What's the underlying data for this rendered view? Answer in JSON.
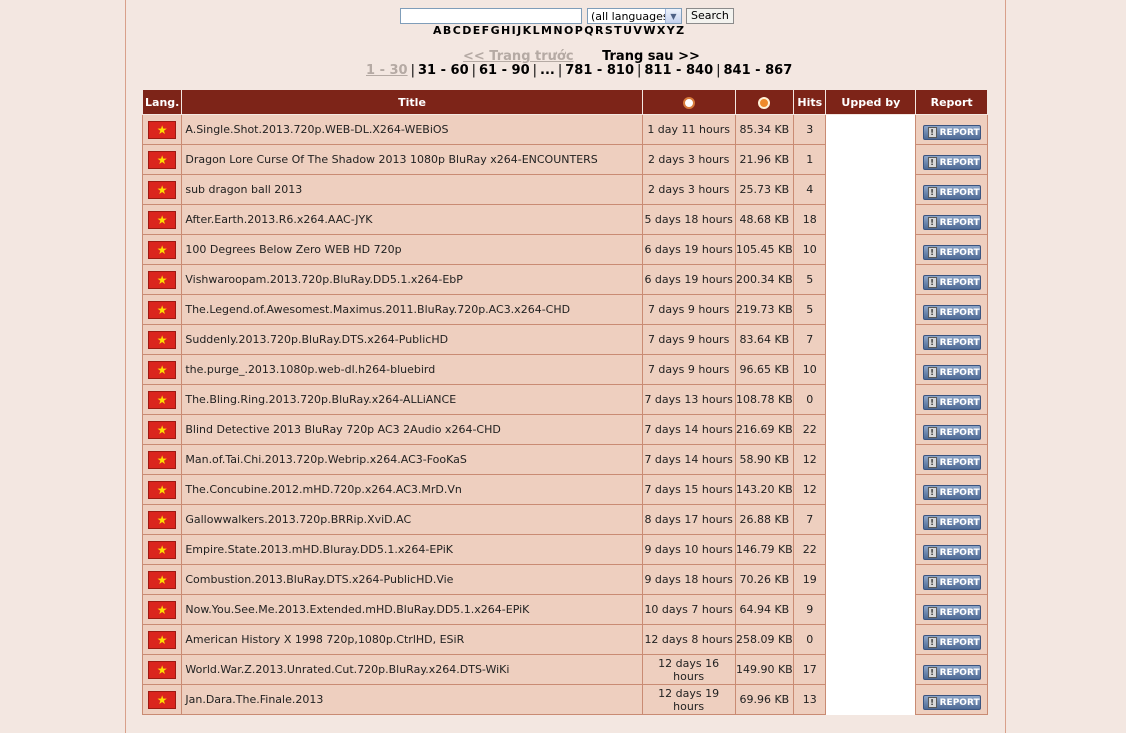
{
  "search": {
    "value": "",
    "language_selected": "(all languages)",
    "button": "Search"
  },
  "alphabet": [
    "A",
    "B",
    "C",
    "D",
    "E",
    "F",
    "G",
    "H",
    "I",
    "J",
    "K",
    "L",
    "M",
    "N",
    "O",
    "P",
    "Q",
    "R",
    "S",
    "T",
    "U",
    "V",
    "W",
    "X",
    "Y",
    "Z"
  ],
  "pager": {
    "prev": "<< Trang trước",
    "next": "Trang sau >>",
    "pages": [
      "1 - 30",
      "31 - 60",
      "61 - 90",
      "...",
      "781 - 810",
      "811 - 840",
      "841 - 867"
    ],
    "current_index": 0
  },
  "table": {
    "headers": {
      "lang": "Lang.",
      "title": "Title",
      "time_icon": "clock-icon",
      "size_icon": "disk-icon",
      "hits": "Hits",
      "upped": "Upped by",
      "report": "Report"
    },
    "report_label": "REPORT",
    "flag_color": "#da251d",
    "rows": [
      {
        "title": "A.Single.Shot.2013.720p.WEB-DL.X264-WEBiOS",
        "time": "1 day 11 hours",
        "size": "85.34 KB",
        "hits": "3"
      },
      {
        "title": "Dragon Lore Curse Of The Shadow 2013 1080p BluRay x264-ENCOUNTERS",
        "time": "2 days 3 hours",
        "size": "21.96 KB",
        "hits": "1"
      },
      {
        "title": "sub dragon ball 2013",
        "time": "2 days 3 hours",
        "size": "25.73 KB",
        "hits": "4"
      },
      {
        "title": "After.Earth.2013.R6.x264.AAC-JYK",
        "time": "5 days 18 hours",
        "size": "48.68 KB",
        "hits": "18"
      },
      {
        "title": "100 Degrees Below Zero WEB HD 720p",
        "time": "6 days 19 hours",
        "size": "105.45 KB",
        "hits": "10"
      },
      {
        "title": "Vishwaroopam.2013.720p.BluRay.DD5.1.x264-EbP",
        "time": "6 days 19 hours",
        "size": "200.34 KB",
        "hits": "5"
      },
      {
        "title": "The.Legend.of.Awesomest.Maximus.2011.BluRay.720p.AC3.x264-CHD",
        "time": "7 days 9 hours",
        "size": "219.73 KB",
        "hits": "5"
      },
      {
        "title": "Suddenly.2013.720p.BluRay.DTS.x264-PublicHD",
        "time": "7 days 9 hours",
        "size": "83.64 KB",
        "hits": "7"
      },
      {
        "title": "the.purge_.2013.1080p.web-dl.h264-bluebird",
        "time": "7 days 9 hours",
        "size": "96.65 KB",
        "hits": "10"
      },
      {
        "title": "The.Bling.Ring.2013.720p.BluRay.x264-ALLiANCE",
        "time": "7 days 13 hours",
        "size": "108.78 KB",
        "hits": "0"
      },
      {
        "title": "Blind Detective 2013 BluRay 720p AC3 2Audio x264-CHD",
        "time": "7 days 14 hours",
        "size": "216.69 KB",
        "hits": "22"
      },
      {
        "title": "Man.of.Tai.Chi.2013.720p.Webrip.x264.AC3-FooKaS",
        "time": "7 days 14 hours",
        "size": "58.90 KB",
        "hits": "12"
      },
      {
        "title": "The.Concubine.2012.mHD.720p.x264.AC3.MrD.Vn",
        "time": "7 days 15 hours",
        "size": "143.20 KB",
        "hits": "12"
      },
      {
        "title": "Gallowwalkers.2013.720p.BRRip.XviD.AC",
        "time": "8 days 17 hours",
        "size": "26.88 KB",
        "hits": "7"
      },
      {
        "title": "Empire.State.2013.mHD.Bluray.DD5.1.x264-EPiK",
        "time": "9 days 10 hours",
        "size": "146.79 KB",
        "hits": "22"
      },
      {
        "title": "Combustion.2013.BluRay.DTS.x264-PublicHD.Vie",
        "time": "9 days 18 hours",
        "size": "70.26 KB",
        "hits": "19"
      },
      {
        "title": "Now.You.See.Me.2013.Extended.mHD.BluRay.DD5.1.x264-EPiK",
        "time": "10 days 7 hours",
        "size": "64.94 KB",
        "hits": "9"
      },
      {
        "title": "American History X 1998 720p,1080p.CtrlHD, ESiR",
        "time": "12 days 8 hours",
        "size": "258.09 KB",
        "hits": "0"
      },
      {
        "title": "World.War.Z.2013.Unrated.Cut.720p.BluRay.x264.DTS-WiKi",
        "time": "12 days 16 hours",
        "size": "149.90 KB",
        "hits": "17"
      },
      {
        "title": "Jan.Dara.The.Finale.2013",
        "time": "12 days 19 hours",
        "size": "69.96 KB",
        "hits": "13"
      }
    ]
  }
}
